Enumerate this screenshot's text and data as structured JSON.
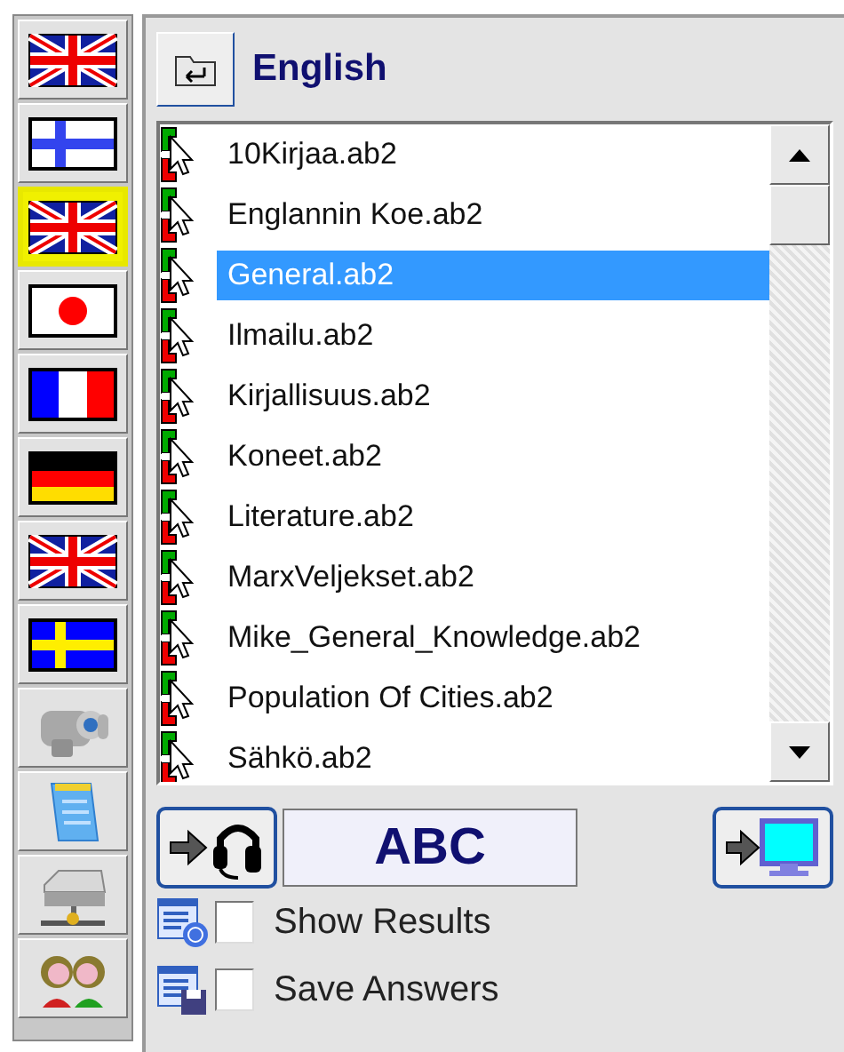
{
  "sidebar": {
    "items": [
      {
        "kind": "uk-flag",
        "selected": false
      },
      {
        "kind": "fi-flag",
        "selected": false
      },
      {
        "kind": "uk-flag",
        "selected": true
      },
      {
        "kind": "jp-flag",
        "selected": false
      },
      {
        "kind": "fr-flag",
        "selected": false
      },
      {
        "kind": "de-flag",
        "selected": false
      },
      {
        "kind": "uk-flag",
        "selected": false
      },
      {
        "kind": "se-flag",
        "selected": false
      },
      {
        "kind": "camera",
        "selected": false
      },
      {
        "kind": "notepad",
        "selected": false
      },
      {
        "kind": "network",
        "selected": false
      },
      {
        "kind": "people",
        "selected": false
      }
    ]
  },
  "folder": {
    "title": "English"
  },
  "files": [
    {
      "name": "10Kirjaa.ab2",
      "selected": false
    },
    {
      "name": "Englannin Koe.ab2",
      "selected": false
    },
    {
      "name": "General.ab2",
      "selected": true
    },
    {
      "name": "Ilmailu.ab2",
      "selected": false
    },
    {
      "name": "Kirjallisuus.ab2",
      "selected": false
    },
    {
      "name": "Koneet.ab2",
      "selected": false
    },
    {
      "name": "Literature.ab2",
      "selected": false
    },
    {
      "name": "MarxVeljekset.ab2",
      "selected": false
    },
    {
      "name": "Mike_General_Knowledge.ab2",
      "selected": false
    },
    {
      "name": "Population Of Cities.ab2",
      "selected": false
    },
    {
      "name": "Sähkö.ab2",
      "selected": false
    }
  ],
  "display": {
    "text": "ABC"
  },
  "options": [
    {
      "kind": "results",
      "label": "Show Results",
      "checked": false
    },
    {
      "kind": "save",
      "label": "Save Answers",
      "checked": false
    }
  ]
}
